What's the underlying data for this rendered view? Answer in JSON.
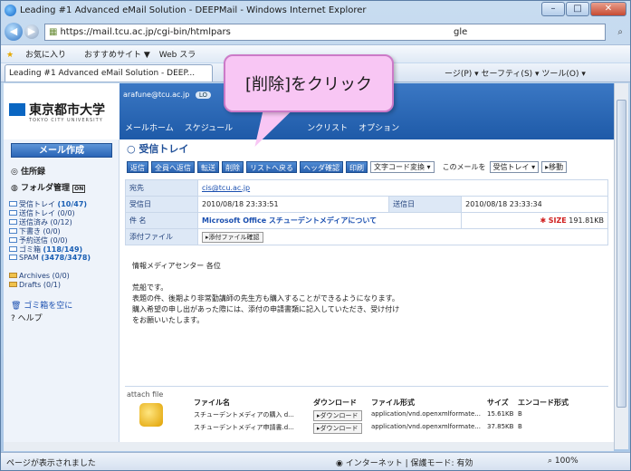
{
  "window": {
    "title": "Leading #1 Advanced eMail Solution - DEEPMail - Windows Internet Explorer",
    "min": "–",
    "max": "□",
    "close": "✕"
  },
  "addressbar": {
    "url": "https://mail.tcu.ac.jp/cgi-bin/htmlpars",
    "right_text": "gle",
    "search_glyph": "⌕"
  },
  "favorites": {
    "label": "お気に入り",
    "recommended": "おすすめサイト ▼",
    "webslice": "Web スラ"
  },
  "tab": {
    "label": "Leading #1 Advanced eMail Solution - DEEP...",
    "commands": "ージ(P) ▾  セーフティ(S) ▾  ツール(O) ▾"
  },
  "webmail": {
    "logo_text": "東京都市大学",
    "logo_sub": "TOKYO CITY UNIVERSITY",
    "user": "arafune@tcu.ac.jp",
    "logout": "LO",
    "menu": [
      "メールホーム",
      "スケジュール",
      "ンクリスト",
      "オプション"
    ]
  },
  "sidebar": {
    "compose": "メール作成",
    "address": "住所録",
    "folder_manage": "フォルダ管理",
    "folder_manage_tag": "ON",
    "folders": [
      {
        "name": "受信トレイ",
        "count": "(10/47)"
      },
      {
        "name": "送信トレイ",
        "count": "(0/0)"
      },
      {
        "name": "送信済み",
        "count": "(0/12)"
      },
      {
        "name": "下書き",
        "count": "(0/0)"
      },
      {
        "name": "予約送信",
        "count": "(0/0)"
      },
      {
        "name": "ゴミ箱",
        "count": "(118/149)"
      },
      {
        "name": "SPAM",
        "count": "(3478/3478)"
      }
    ],
    "folders2": [
      {
        "name": "Archives",
        "count": "(0/0)"
      },
      {
        "name": "Drafts",
        "count": "(0/1)"
      }
    ],
    "empty_trash": "ゴミ箱を空に",
    "help": "ヘルプ"
  },
  "main": {
    "title": "受信トレイ",
    "toolbar": [
      "返信",
      "全員へ返信",
      "転送",
      "削除",
      "リストへ戻る",
      "ヘッダ確認",
      "印刷"
    ],
    "charset": "文字コード変換 ▾",
    "move_label": "このメールを",
    "move_target": "受信トレイ ▾",
    "move_button": "移動",
    "to_label": "宛先",
    "to_value": "cis@tcu.ac.jp",
    "recv_label": "受信日",
    "recv_value": "2010/08/18 23:33:51",
    "sent_label": "送信日",
    "sent_value": "2010/08/18 23:33:34",
    "subject_label": "件 名",
    "subject_value": "Microsoft Office スチューデントメディアについて",
    "size_label": "SIZE",
    "size_value": "191.81KB",
    "attach_label": "添付ファイル",
    "attach_button": "添付ファイル確認",
    "body": "情報メディアセンター 各位\n\n荒船です。\n表題の件、後期より非常勤講師の先生方も購入することができるようになります。\n購入希望の申し出があった際には、添付の申請書類に記入していただき、受け付け\nをお願いいたします。"
  },
  "attachments": {
    "area_label": "attach file",
    "headers": [
      "ファイル名",
      "ダウンロード",
      "ファイル形式",
      "サイズ",
      "エンコード形式"
    ],
    "rows": [
      {
        "name": "スチューデントメディアの購入 d...",
        "download": "ダウンロード",
        "type": "application/vnd.openxmlformate...",
        "size": "15.61KB",
        "enc": "B"
      },
      {
        "name": "スチューデントメディア申請書.d...",
        "download": "ダウンロード",
        "type": "application/vnd.openxmlformate...",
        "size": "37.85KB",
        "enc": "B"
      }
    ]
  },
  "callout": {
    "text": "[削除]をクリック"
  },
  "statusbar": {
    "left": "ページが表示されました",
    "mid": "インターネット | 保護モード: 有効",
    "right": "100%"
  }
}
